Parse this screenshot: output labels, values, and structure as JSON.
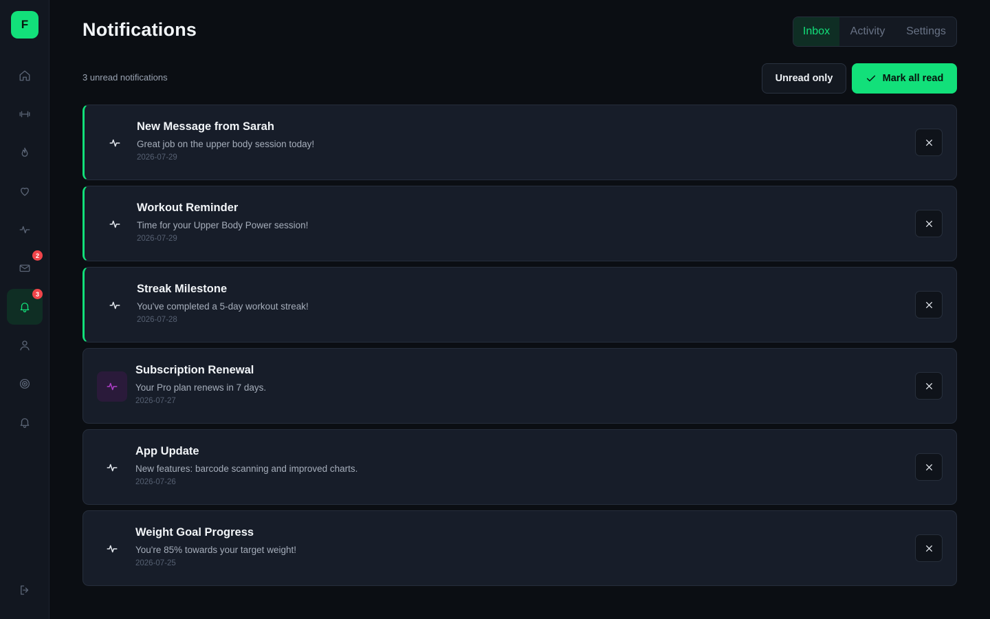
{
  "app": {
    "logo_letter": "F",
    "brand_color": "#12e07a"
  },
  "sidebar": {
    "items": [
      {
        "name": "home",
        "icon": "home-icon",
        "active": false
      },
      {
        "name": "workouts",
        "icon": "dumbbell-icon",
        "active": false
      },
      {
        "name": "nutrition",
        "icon": "flame-icon",
        "active": false
      },
      {
        "name": "health",
        "icon": "heart-icon",
        "active": false
      },
      {
        "name": "activity",
        "icon": "pulse-icon",
        "active": false
      },
      {
        "name": "messages",
        "icon": "mail-icon",
        "active": false,
        "badge": "2"
      },
      {
        "name": "notifications",
        "icon": "bell-icon",
        "active": true,
        "badge": "3"
      },
      {
        "name": "profile",
        "icon": "user-icon",
        "active": false
      },
      {
        "name": "goals",
        "icon": "target-icon",
        "active": false
      },
      {
        "name": "alerts",
        "icon": "bell-icon",
        "active": false
      }
    ],
    "logout_icon": "logout-icon"
  },
  "header": {
    "title": "Notifications",
    "tabs": [
      {
        "label": "Inbox",
        "active": true
      },
      {
        "label": "Activity",
        "active": false
      },
      {
        "label": "Settings",
        "active": false
      }
    ]
  },
  "toolbar": {
    "unread_count_text": "3 unread notifications",
    "unread_only_label": "Unread only",
    "mark_all_label": "Mark all read"
  },
  "notifications": [
    {
      "title": "New Message from Sarah",
      "message": "Great job on the upper body session today!",
      "date": "2026-07-29",
      "unread": true,
      "icon": "pulse-icon"
    },
    {
      "title": "Workout Reminder",
      "message": "Time for your Upper Body Power session!",
      "date": "2026-07-29",
      "unread": true,
      "icon": "pulse-icon"
    },
    {
      "title": "Streak Milestone",
      "message": "You've completed a 5-day workout streak!",
      "date": "2026-07-28",
      "unread": true,
      "icon": "pulse-icon"
    },
    {
      "title": "Subscription Renewal",
      "message": "Your Pro plan renews in 7 days.",
      "date": "2026-07-27",
      "unread": false,
      "icon": "pulse-icon",
      "icon_color": "#b03fc9"
    },
    {
      "title": "App Update",
      "message": "New features: barcode scanning and improved charts.",
      "date": "2026-07-26",
      "unread": false,
      "icon": "pulse-icon"
    },
    {
      "title": "Weight Goal Progress",
      "message": "You're 85% towards your target weight!",
      "date": "2026-07-25",
      "unread": false,
      "icon": "pulse-icon"
    }
  ]
}
